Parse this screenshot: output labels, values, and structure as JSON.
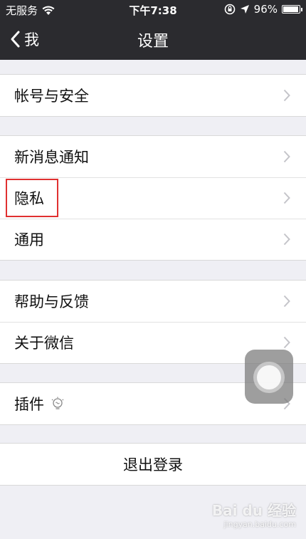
{
  "status_bar": {
    "carrier": "无服务",
    "time": "下午7:38",
    "battery_percent": "96%",
    "icons": [
      "wifi-icon",
      "rotation-lock-icon",
      "location-icon",
      "battery-icon"
    ]
  },
  "navbar": {
    "back_label": "我",
    "title": "设置"
  },
  "groups": {
    "account": {
      "label": "帐号与安全"
    },
    "notifications": {
      "label": "新消息通知"
    },
    "privacy": {
      "label": "隐私"
    },
    "general": {
      "label": "通用"
    },
    "help": {
      "label": "帮助与反馈"
    },
    "about": {
      "label": "关于微信"
    },
    "plugins": {
      "label": "插件",
      "icon": "lightbulb-icon"
    },
    "logout": {
      "label": "退出登录"
    }
  },
  "watermark": {
    "brand": "Bai du 经验",
    "url": "jingyan.baidu.com"
  },
  "colors": {
    "navbar_bg": "#2b2b2f",
    "page_bg": "#efeff4",
    "highlight_border": "#e03030"
  }
}
